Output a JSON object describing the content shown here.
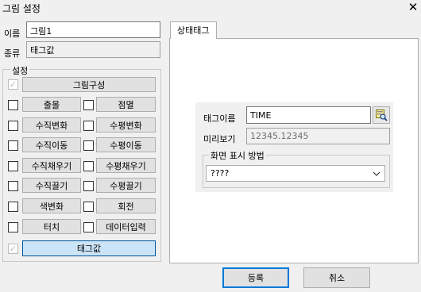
{
  "window": {
    "title": "그림 설정",
    "close_glyph": "✕"
  },
  "name_label": "이름",
  "name_value": "그림1",
  "type_label": "종류",
  "type_value": "태그값",
  "settings_group_title": "설정",
  "settings": {
    "picture_composition": "그림구성",
    "rows": [
      {
        "left": "출몰",
        "right": "점멸"
      },
      {
        "left": "수직변화",
        "right": "수평변화"
      },
      {
        "left": "수직이동",
        "right": "수평이동"
      },
      {
        "left": "수직채우기",
        "right": "수평채우기"
      },
      {
        "left": "수직끌기",
        "right": "수평끌기"
      },
      {
        "left": "색변화",
        "right": "회전"
      },
      {
        "left": "터치",
        "right": "데이터입력"
      }
    ],
    "tag_value": "태그값"
  },
  "tab": {
    "label": "상태태그"
  },
  "tag_panel": {
    "tag_name_label": "태그이름",
    "tag_name_value": "TIME",
    "preview_label": "미리보기",
    "preview_value": "12345.12345",
    "display_group_title": "화면 표시 방법",
    "display_selected": "????"
  },
  "buttons": {
    "ok": "등록",
    "cancel": "취소"
  },
  "icons": {
    "tag_browse": "tag-browse-icon",
    "dropdown": "chevron-down-icon",
    "close": "close-icon",
    "check": "check-icon"
  }
}
